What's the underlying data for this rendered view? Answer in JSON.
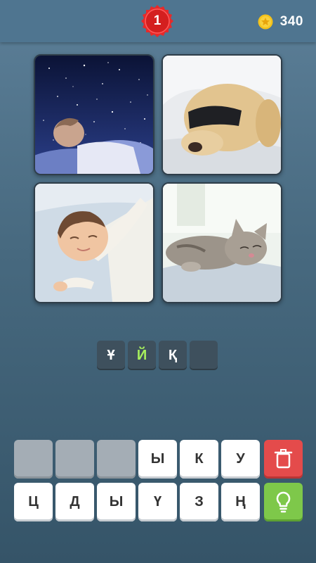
{
  "header": {
    "level": "1",
    "coins": "340",
    "coin_icon": "coin-star-icon"
  },
  "photos": [
    {
      "subject": "child-sleeping-under-stars"
    },
    {
      "subject": "dog-sleeping-with-eye-mask"
    },
    {
      "subject": "baby-sleeping-arms-stretched"
    },
    {
      "subject": "kitten-sleeping-on-blanket"
    }
  ],
  "answer": {
    "slots": [
      {
        "letter": "Ұ",
        "state": "filled"
      },
      {
        "letter": "Й",
        "state": "hint"
      },
      {
        "letter": "Қ",
        "state": "filled"
      },
      {
        "letter": "",
        "state": "empty"
      }
    ]
  },
  "keyboard": {
    "row1": [
      "",
      "",
      "",
      "Ы",
      "К",
      "У"
    ],
    "row2": [
      "Ц",
      "Д",
      "Ы",
      "Ү",
      "З",
      "Ң"
    ],
    "delete_icon": "trash-icon",
    "hint_icon": "lightbulb-icon"
  },
  "colors": {
    "background": "#47697f",
    "delete": "#e44b4b",
    "hint": "#7ec84a",
    "hint_letter": "#a7f05d",
    "badge": "#e62a2a",
    "coin": "#f4c21a"
  }
}
